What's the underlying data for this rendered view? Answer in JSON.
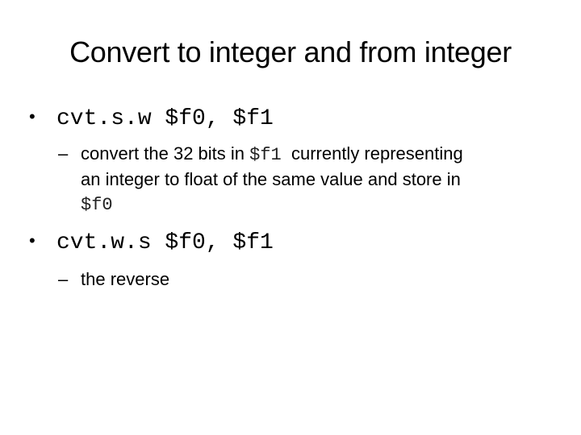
{
  "slide": {
    "title": "Convert to integer and from integer",
    "bullets": [
      {
        "code": "cvt.s.w $f0, $f1",
        "sub": {
          "dash": "–",
          "text_before": "convert the 32 bits in ",
          "code1": "$f1",
          "text_after": "  currently representing",
          "line2": "an integer to float of the same value and store in",
          "code2": "$f0"
        }
      },
      {
        "code": "cvt.w.s $f0, $f1",
        "sub": {
          "dash": "–",
          "text": "the reverse"
        }
      }
    ],
    "bullet_glyph": "•"
  }
}
